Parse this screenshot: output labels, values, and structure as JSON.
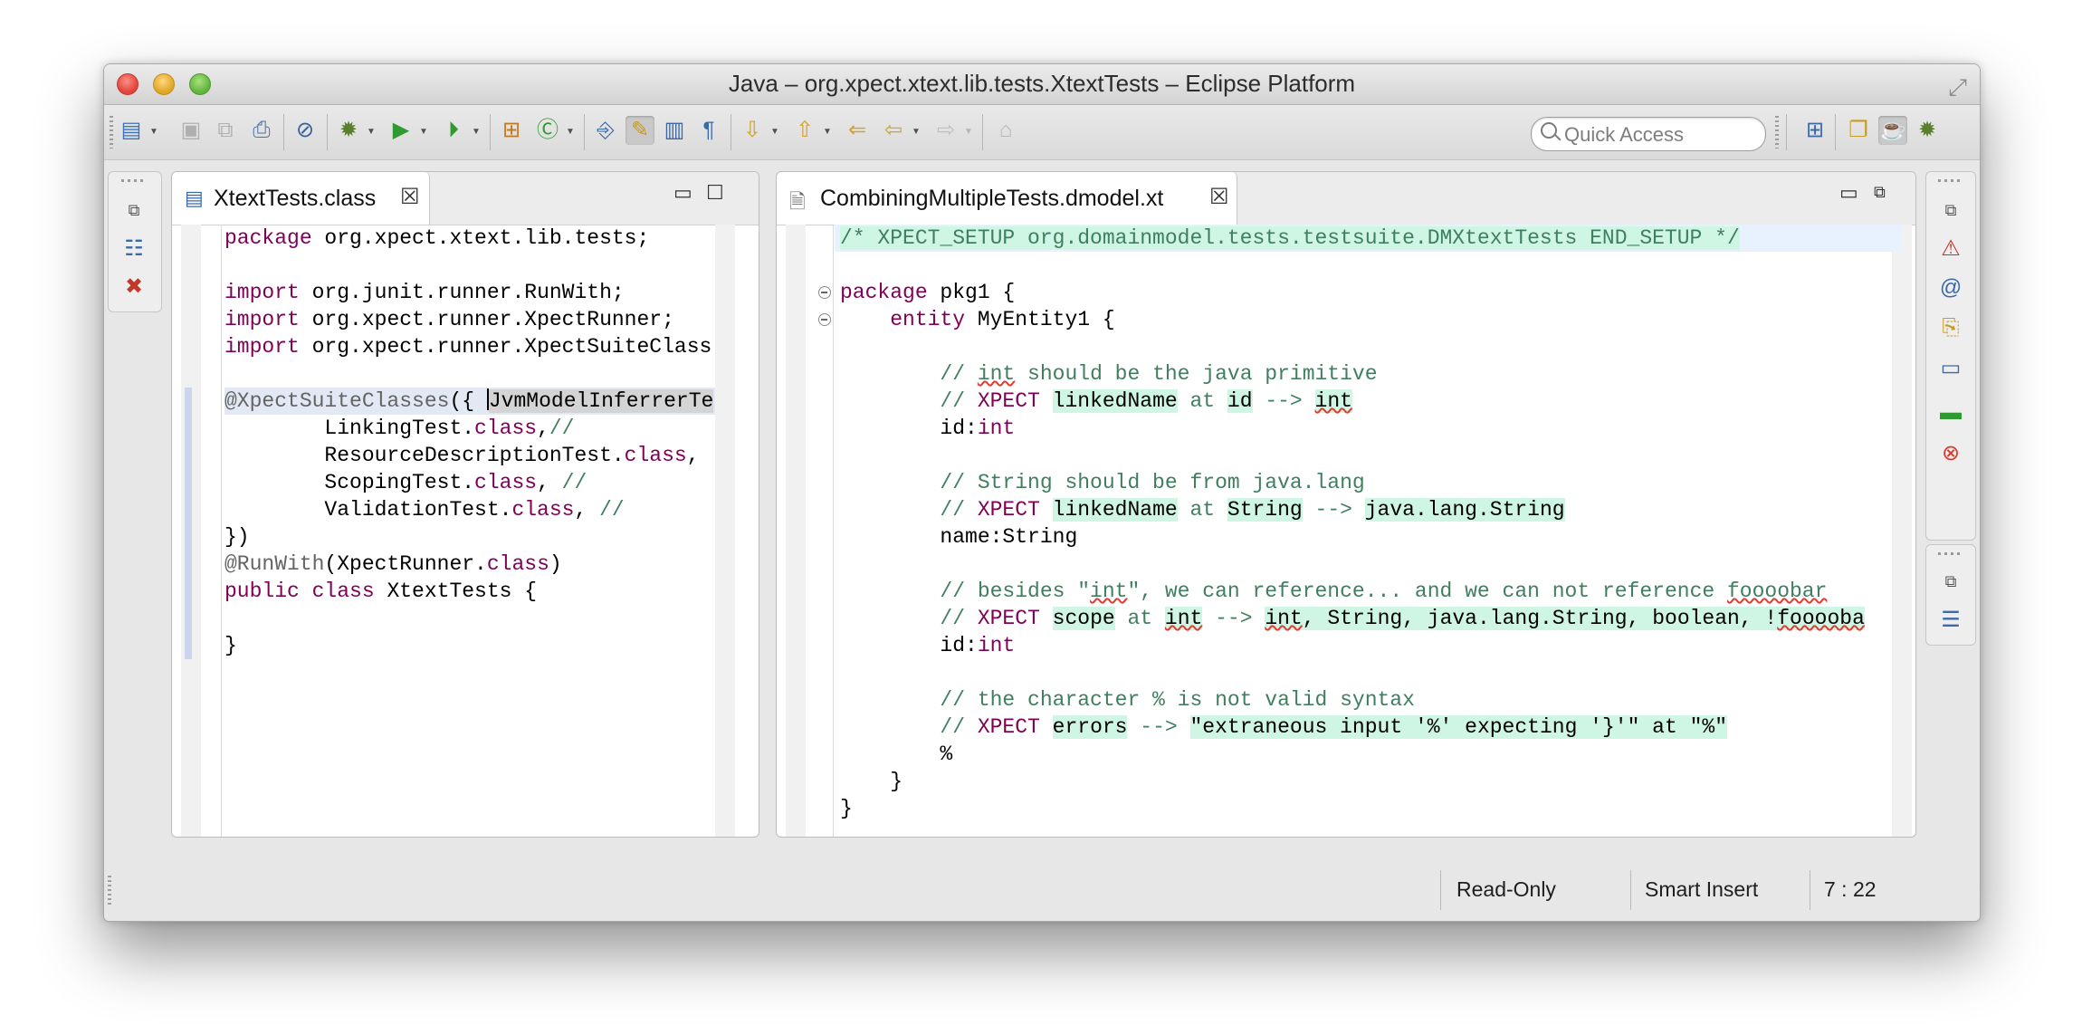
{
  "window": {
    "title": "Java – org.xpect.xtext.lib.tests.XtextTests – Eclipse Platform"
  },
  "toolbar": {
    "quick_access_placeholder": "Quick Access",
    "icons": [
      "new-icon",
      "save-icon",
      "save-all-icon",
      "print-icon",
      "skip-breakpoints-icon",
      "debug-icon",
      "run-icon",
      "external-tools-icon",
      "new-package-icon",
      "new-class-icon",
      "open-type-icon",
      "mark-occurrences-icon",
      "toggle-block-selection-icon",
      "show-whitespace-icon",
      "next-annotation-icon",
      "previous-annotation-icon",
      "last-edit-location-icon",
      "back-icon",
      "forward-icon",
      "pin-editor-icon",
      "open-perspective-icon",
      "resource-perspective-icon",
      "java-perspective-icon",
      "debug-perspective-icon"
    ]
  },
  "left_editor": {
    "tab_label": "XtextTests.class",
    "lines": [
      "package org.xpect.xtext.lib.tests;",
      "",
      "import org.junit.runner.RunWith;",
      "import org.xpect.runner.XpectRunner;",
      "import org.xpect.runner.XpectSuiteClass",
      "",
      "@XpectSuiteClasses({ ",
      "JvmModelInferrerTe",
      "        LinkingTest.class,//",
      "        ResourceDescriptionTest.class,",
      "        ScopingTest.class, //",
      "        ValidationTest.class, //",
      "})",
      "@RunWith(XpectRunner.class)",
      "public class XtextTests {",
      "}"
    ]
  },
  "right_editor": {
    "tab_label": "CombiningMultipleTests.dmodel.xt",
    "setup_comment": "/* XPECT_SETUP org.domainmodel.tests.testsuite.DMXtextTests END_SETUP */",
    "l_package": "package pkg1 {",
    "l_entity": "    entity MyEntity1 {",
    "c1": "// int should be the java primitive",
    "x1": "// XPECT linkedName at id --> int",
    "d1": "id:int",
    "c2": "// String should be from java.lang",
    "x2": "// XPECT linkedName at String --> java.lang.String",
    "d2": "name:String",
    "c3": "// besides \"int\", we can reference... and we can not reference foooobar",
    "x3": "// XPECT scope at int --> int, String, java.lang.String, boolean, !fooooba",
    "d3": "id:int",
    "c4": "// the character % is not valid syntax",
    "x4": "// XPECT errors --> \"extraneous input '%' expecting '}'\" at \"%\"",
    "d4": "%",
    "close_entity": "    }",
    "close_package": "}"
  },
  "status": {
    "mode": "Read-Only",
    "insert": "Smart Insert",
    "position": "7 : 22"
  }
}
